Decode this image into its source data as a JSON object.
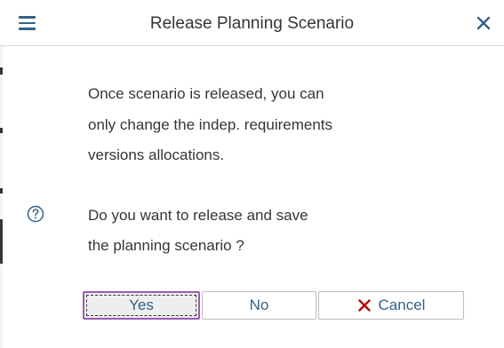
{
  "dialog": {
    "title": "Release Planning Scenario"
  },
  "message": {
    "lines": [
      "Once scenario is released, you can",
      "only change the indep. requirements",
      "versions allocations."
    ],
    "question_lines": [
      "Do you want to release and save",
      "the planning scenario ?"
    ]
  },
  "buttons": {
    "yes": "Yes",
    "no": "No",
    "cancel": "Cancel"
  },
  "icons": {
    "menu": "hamburger-menu-icon",
    "close": "close-icon",
    "question": "question-circle-icon",
    "cancel": "red-x-icon"
  },
  "colors": {
    "accent": "#346187",
    "cancel_red": "#bb0000",
    "focus_border": "#9b59b6"
  }
}
